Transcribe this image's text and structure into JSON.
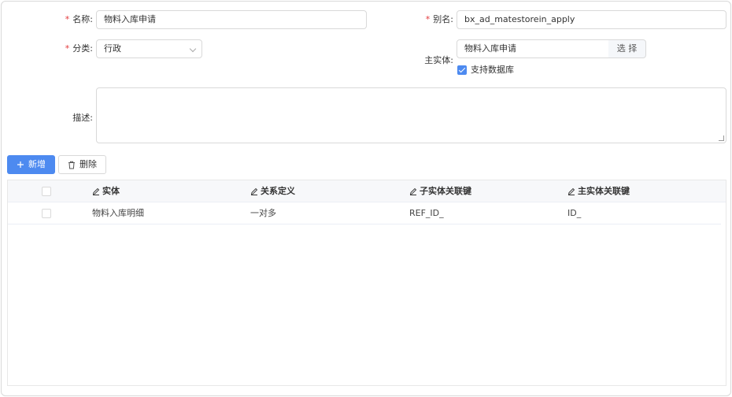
{
  "form": {
    "name_label": "名称:",
    "name_value": "物料入库申请",
    "alias_label": "别名:",
    "alias_value": "bx_ad_matestorein_apply",
    "category_label": "分类:",
    "category_value": "行政",
    "main_entity_label": "主实体:",
    "main_entity_value": "物料入库申请",
    "choose_button": "选 择",
    "support_db_label": "支持数据库",
    "description_label": "描述:",
    "description_value": ""
  },
  "toolbar": {
    "add_label": "新增",
    "delete_label": "删除"
  },
  "table": {
    "columns": [
      "实体",
      "关系定义",
      "子实体关联键",
      "主实体关联键"
    ],
    "rows": [
      [
        "物料入库明细",
        "一对多",
        "REF_ID_",
        "ID_"
      ]
    ]
  },
  "colors": {
    "accent": "#4d8af0",
    "required": "#e4393c"
  }
}
